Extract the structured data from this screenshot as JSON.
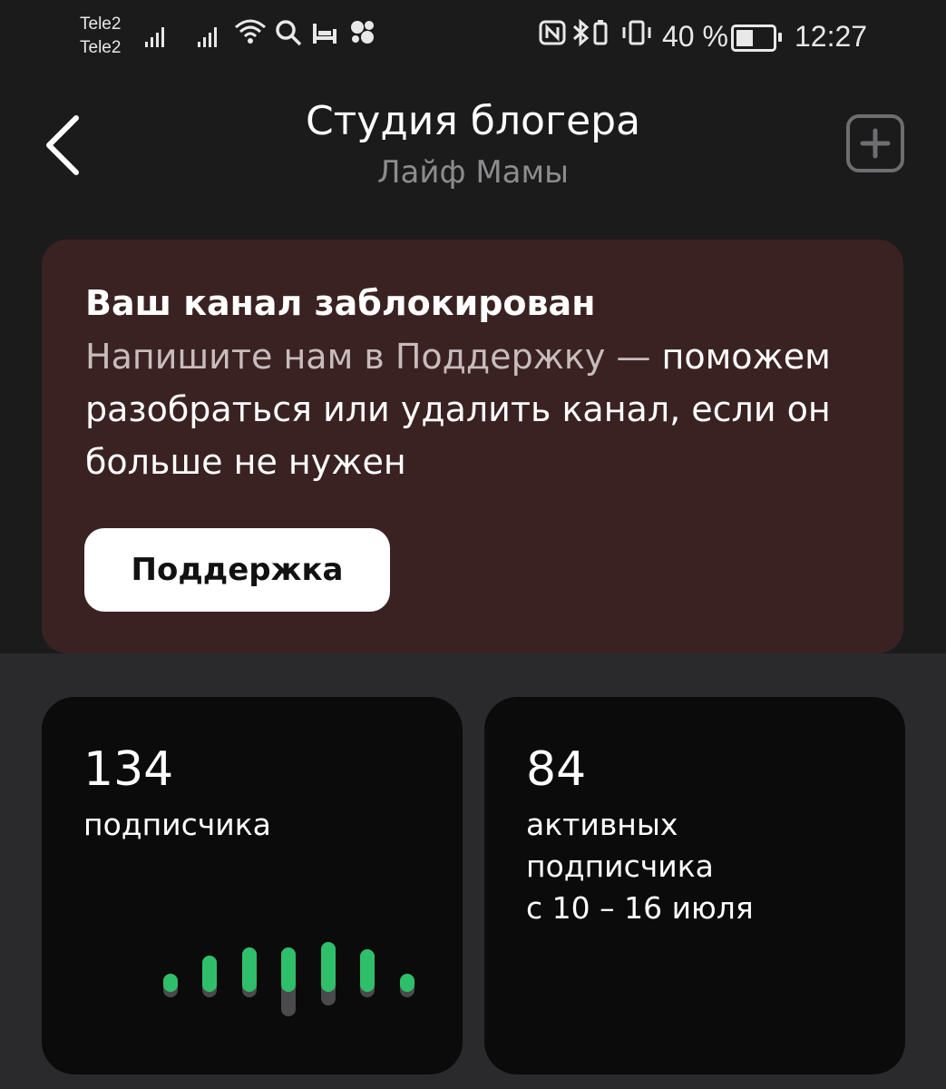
{
  "status_bar": {
    "carrier_1": "Tele2",
    "carrier_2": "Tele2",
    "battery_percent": "40 %",
    "battery_level": 0.4,
    "time": "12:27",
    "icons": [
      "signal-icon",
      "signal-icon",
      "wifi-icon",
      "search-icon",
      "bed-icon",
      "app-icon",
      "nfc-icon",
      "bluetooth-icon",
      "vibrate-icon",
      "battery-icon"
    ]
  },
  "header": {
    "title": "Студия блогера",
    "subtitle": "Лайф Мамы"
  },
  "blocked_card": {
    "title": "Ваш канал заблокирован",
    "text_muted": "Напишите нам в Поддержку —",
    "text_main": "поможем разобраться или удалить канал, если он больше не нужен",
    "button_label": "Поддержка"
  },
  "stats": {
    "subscribers": {
      "value": "134",
      "label": "подписчика"
    },
    "active": {
      "value": "84",
      "label_line1": "активных",
      "label_line2": "подписчика",
      "period": "с 10 – 16 июля"
    }
  },
  "colors": {
    "accent_green": "#2fbf6a",
    "card_blocked_bg": "#3a2223",
    "bar_track": "#4a4a4c"
  }
}
